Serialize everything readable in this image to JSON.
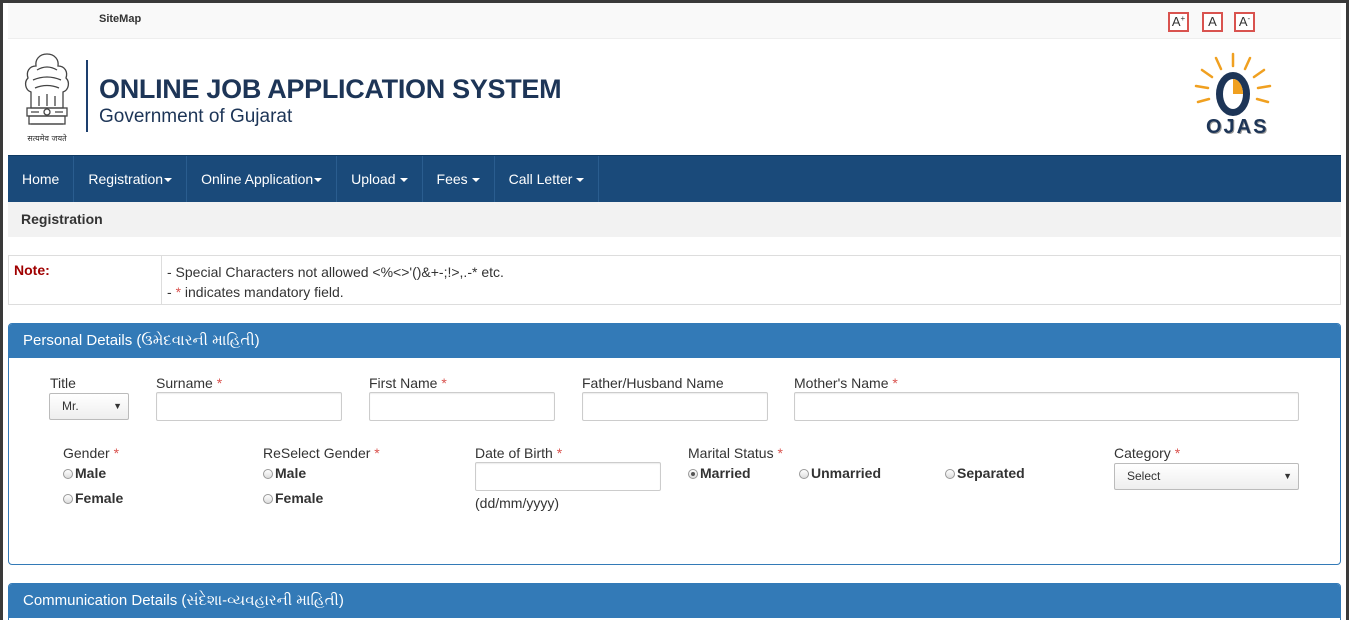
{
  "top": {
    "sitemap": "SiteMap",
    "font_increase": "A",
    "font_normal": "A",
    "font_decrease": "A",
    "plus": "+",
    "minus": "-"
  },
  "header": {
    "title": "ONLINE JOB APPLICATION SYSTEM",
    "subtitle": "Government of Gujarat",
    "emblem_motto": "सत्यमेव जयते",
    "logo_text": "OJAS"
  },
  "nav": {
    "items": [
      {
        "label": "Home",
        "dropdown": false
      },
      {
        "label": "Registration",
        "dropdown": true
      },
      {
        "label": "Online Application",
        "dropdown": true
      },
      {
        "label": "Upload",
        "dropdown": true
      },
      {
        "label": "Fees",
        "dropdown": true
      },
      {
        "label": "Call Letter",
        "dropdown": true
      }
    ]
  },
  "breadcrumb": "Registration",
  "note": {
    "label": "Note:",
    "line1": "- Special Characters not allowed <%<>'()&+-;!>,.-* etc.",
    "line2_prefix": "- ",
    "line2_star": "*",
    "line2_rest": " indicates mandatory field."
  },
  "personal": {
    "heading": "Personal Details (ઉમેદવારની માહિતી)",
    "title_label": "Title",
    "title_value": "Mr.",
    "surname_label": "Surname",
    "firstname_label": "First Name",
    "father_label": "Father/Husband Name",
    "mother_label": "Mother's Name",
    "gender_label": "Gender",
    "regender_label": "ReSelect Gender",
    "dob_label": "Date of Birth",
    "dob_hint": "(dd/mm/yyyy)",
    "marital_label": "Marital Status",
    "category_label": "Category",
    "category_value": "Select",
    "male": "Male",
    "female": "Female",
    "married": "Married",
    "unmarried": "Unmarried",
    "separated": "Separated",
    "star": "*"
  },
  "communication": {
    "heading": "Communication Details (સંદેશા-વ્યવહારની માહિતી)"
  },
  "colors": {
    "nav": "#1a4a7a",
    "panel": "#337ab7",
    "required": "#d9534f"
  }
}
